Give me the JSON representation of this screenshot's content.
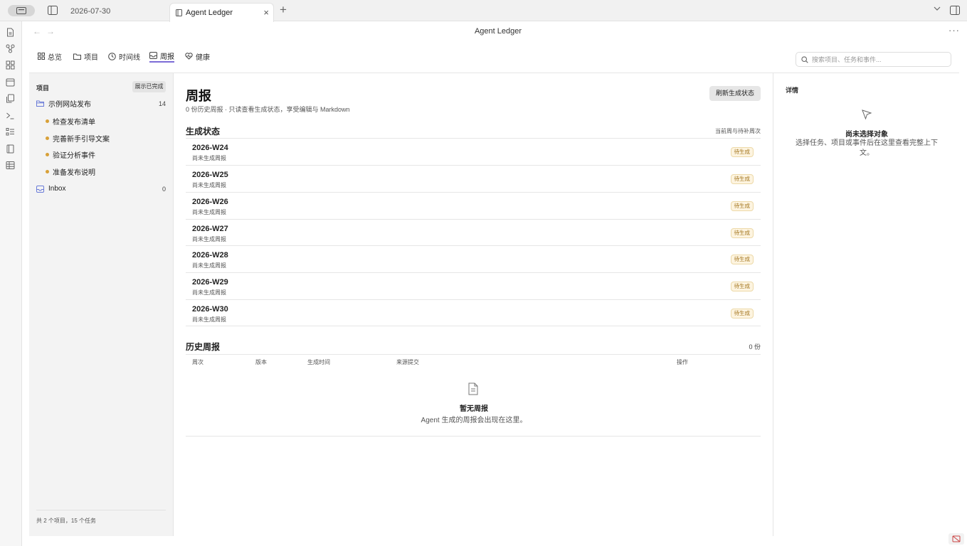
{
  "tabs": {
    "date_tab": "2026-07-30",
    "active_tab": "Agent Ledger",
    "close": "×",
    "add": "+"
  },
  "view": {
    "title": "Agent Ledger",
    "more": "···"
  },
  "nav": {
    "tabs": [
      {
        "label": "总览",
        "icon": "grid-icon"
      },
      {
        "label": "项目",
        "icon": "folder-icon"
      },
      {
        "label": "时间线",
        "icon": "clock-icon"
      },
      {
        "label": "周报",
        "icon": "inbox-icon",
        "active": true
      },
      {
        "label": "健康",
        "icon": "heart-pulse-icon"
      }
    ]
  },
  "search": {
    "placeholder": "搜索项目、任务和事件..."
  },
  "left": {
    "title": "项目",
    "show_done": "展示已完成",
    "projects": [
      {
        "name": "示例网站发布",
        "count": "14",
        "icon": "folder-open-icon",
        "tasks": [
          "检查发布清单",
          "完善新手引导文案",
          "验证分析事件",
          "准备发布说明"
        ]
      },
      {
        "name": "Inbox",
        "count": "0",
        "icon": "inbox-icon",
        "tasks": []
      }
    ],
    "footer": "共 2 个项目，15 个任务"
  },
  "main": {
    "title": "周报",
    "subtitle": "0 份历史周报 · 只读查看生成状态，享受编辑与 Markdown",
    "refresh": "刷新生成状态",
    "gen_title": "生成状态",
    "gen_hint": "当前周与待补周次",
    "weeks": [
      {
        "name": "2026-W24",
        "sub": "尚未生成周报",
        "badge": "待生成"
      },
      {
        "name": "2026-W25",
        "sub": "尚未生成周报",
        "badge": "待生成"
      },
      {
        "name": "2026-W26",
        "sub": "尚未生成周报",
        "badge": "待生成"
      },
      {
        "name": "2026-W27",
        "sub": "尚未生成周报",
        "badge": "待生成"
      },
      {
        "name": "2026-W28",
        "sub": "尚未生成周报",
        "badge": "待生成"
      },
      {
        "name": "2026-W29",
        "sub": "尚未生成周报",
        "badge": "待生成"
      },
      {
        "name": "2026-W30",
        "sub": "尚未生成周报",
        "badge": "待生成"
      }
    ],
    "hist_title": "历史周报",
    "hist_count": "0 份",
    "hist_cols": [
      "周次",
      "版本",
      "生成时间",
      "来源提交",
      "操作"
    ],
    "empty_title": "暂无周报",
    "empty_sub": "Agent 生成的周报会出现在这里。"
  },
  "detail": {
    "title": "详情",
    "empty_title": "尚未选择对象",
    "empty_sub": "选择任务、项目或事件后在这里查看完整上下文。"
  },
  "colors": {
    "accent": "#7c6bd6",
    "badge_text": "#a2741c",
    "task_dot": "#d8a037",
    "folder": "#6a7bd8"
  }
}
